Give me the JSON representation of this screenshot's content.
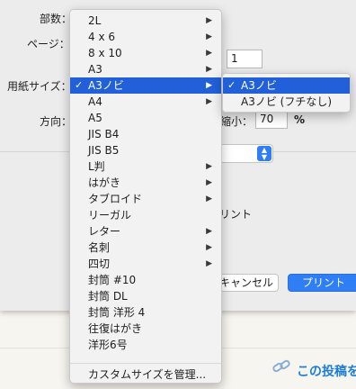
{
  "colors": {
    "accent": "#2160d8",
    "button_blue": "#2f7ef6",
    "link": "#1d7dd6"
  },
  "dialog": {
    "copies_label": "部数：",
    "pages_label": "ページ：",
    "paper_size_label": "用紙サイズ：",
    "orientation_label": "方向：",
    "pages_to_value": "1",
    "scale_label": "縮小：",
    "scale_value": "70",
    "scale_unit": "%",
    "print_option_tail": "リント",
    "cancel_label": "キャンセル",
    "print_label": "プリント"
  },
  "paper_menu": {
    "items": [
      {
        "label": "2L",
        "has_submenu": true
      },
      {
        "label": "4 x 6",
        "has_submenu": true
      },
      {
        "label": "8 x 10",
        "has_submenu": true
      },
      {
        "label": "A3",
        "has_submenu": true
      },
      {
        "label": "A3ノビ",
        "has_submenu": true,
        "checked": true,
        "highlighted": true
      },
      {
        "label": "A4",
        "has_submenu": true
      },
      {
        "label": "A5",
        "has_submenu": false
      },
      {
        "label": "JIS B4",
        "has_submenu": false
      },
      {
        "label": "JIS B5",
        "has_submenu": false
      },
      {
        "label": "L判",
        "has_submenu": true
      },
      {
        "label": "はがき",
        "has_submenu": true
      },
      {
        "label": "タブロイド",
        "has_submenu": true
      },
      {
        "label": "リーガル",
        "has_submenu": false
      },
      {
        "label": "レター",
        "has_submenu": true
      },
      {
        "label": "名刺",
        "has_submenu": true
      },
      {
        "label": "四切",
        "has_submenu": true
      },
      {
        "label": "封筒 #10",
        "has_submenu": false
      },
      {
        "label": "封筒 DL",
        "has_submenu": false
      },
      {
        "label": "封筒 洋形 4",
        "has_submenu": false
      },
      {
        "label": "往復はがき",
        "has_submenu": false
      },
      {
        "label": "洋形6号",
        "has_submenu": false
      }
    ],
    "manage_label": "カスタムサイズを管理..."
  },
  "submenu": {
    "items": [
      {
        "label": "A3ノビ",
        "checked": true,
        "highlighted": true
      },
      {
        "label": "A3ノビ (フチなし)",
        "checked": false,
        "highlighted": false
      }
    ]
  },
  "page": {
    "post_link": "この投稿を"
  },
  "icons": {
    "check": "checkmark-icon",
    "arrow": "chevron-right-icon",
    "link": "link-icon",
    "stepper": "up-down-chevron-icon"
  }
}
